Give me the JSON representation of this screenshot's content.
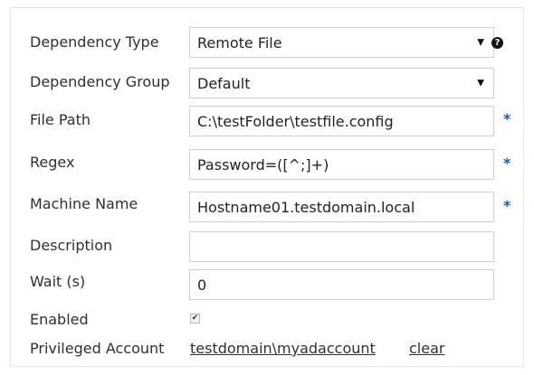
{
  "form": {
    "dependency_type": {
      "label": "Dependency Type",
      "value": "Remote File"
    },
    "dependency_group": {
      "label": "Dependency Group",
      "value": "Default"
    },
    "file_path": {
      "label": "File Path",
      "value": "C:\\testFolder\\testfile.config",
      "required_mark": "*"
    },
    "regex": {
      "label": "Regex",
      "value": "Password=([^;]+)",
      "required_mark": "*"
    },
    "machine_name": {
      "label": "Machine Name",
      "value": "Hostname01.testdomain.local",
      "required_mark": "*"
    },
    "description": {
      "label": "Description",
      "value": ""
    },
    "wait": {
      "label": "Wait (s)",
      "value": "0"
    },
    "enabled": {
      "label": "Enabled",
      "checked": true
    },
    "privileged_account": {
      "label": "Privileged Account",
      "account": "testdomain\\myadaccount",
      "clear": "clear"
    }
  },
  "icons": {
    "help": "question-circle-icon",
    "dropdown": "caret-down-icon",
    "check": "check-icon"
  },
  "colors": {
    "required_mark": "#2b57a6",
    "border": "#cfcfcf"
  }
}
